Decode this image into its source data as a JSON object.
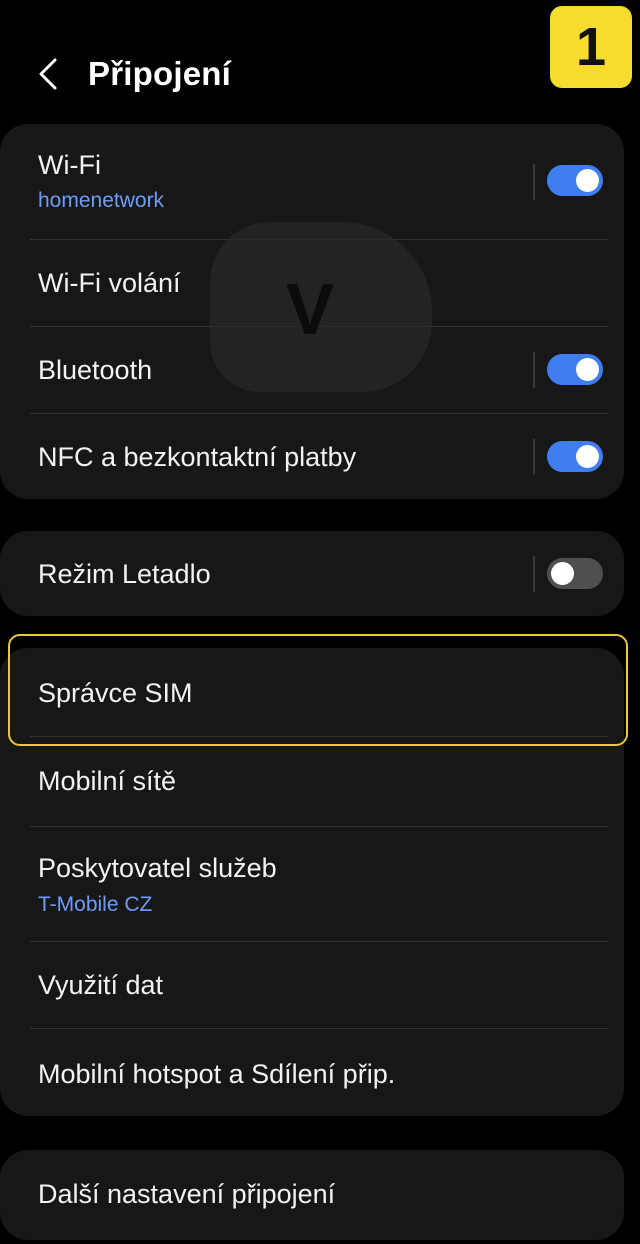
{
  "header": {
    "title": "Připojení",
    "back_icon": "chevron-left-icon",
    "badge": "1"
  },
  "colors": {
    "background": "#000000",
    "card": "#171717",
    "accent_blue": "#3f7ef0",
    "subtitle_blue": "#6f9df5",
    "highlight_yellow": "#e9c63a",
    "badge_yellow": "#f7dc2f"
  },
  "overlay": {
    "touch_letter": "V"
  },
  "group1": {
    "wifi": {
      "title": "Wi-Fi",
      "subtitle": "homenetwork",
      "toggle": "on"
    },
    "wifi_calling": {
      "title": "Wi-Fi volání"
    },
    "bluetooth": {
      "title": "Bluetooth",
      "toggle": "on"
    },
    "nfc": {
      "title": "NFC a bezkontaktní platby",
      "toggle": "on"
    }
  },
  "group2": {
    "airplane": {
      "title": "Režim Letadlo",
      "toggle": "off"
    }
  },
  "group3": {
    "sim_manager": {
      "title": "Správce SIM"
    },
    "mobile_networks": {
      "title": "Mobilní sítě"
    },
    "service_provider": {
      "title": "Poskytovatel služeb",
      "subtitle": "T-Mobile CZ"
    },
    "data_usage": {
      "title": "Využití dat"
    },
    "hotspot": {
      "title": "Mobilní hotspot a Sdílení přip."
    }
  },
  "group4": {
    "more_settings": {
      "title": "Další nastavení připojení"
    }
  }
}
